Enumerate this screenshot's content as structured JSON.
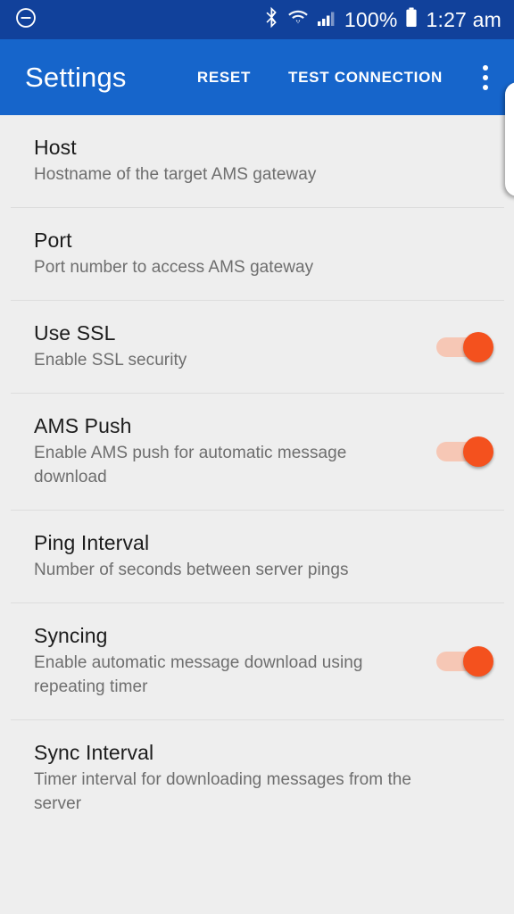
{
  "status_bar": {
    "dnd_icon": "do-not-disturb-icon",
    "bluetooth_icon": "bluetooth-icon",
    "wifi_icon": "wifi-icon",
    "signal_icon": "cellular-signal-icon",
    "battery_percent": "100%",
    "battery_icon": "battery-full-icon",
    "time": "1:27 am",
    "background_color": "#11419b"
  },
  "app_bar": {
    "title": "Settings",
    "reset_label": "RESET",
    "test_connection_label": "TEST CONNECTION",
    "overflow_icon": "overflow-menu-icon",
    "background_color": "#1665cb"
  },
  "side_card": {
    "name": "peeking-panel"
  },
  "theme": {
    "accent_color": "#f4511e",
    "switch_track_color": "#f6c7b5",
    "list_background": "#eeeeee",
    "divider_color": "#dddddd",
    "title_color": "#1c1c1c",
    "summary_color": "#6e6e6e"
  },
  "preferences": [
    {
      "key": "host",
      "title": "Host",
      "summary": "Hostname of the target AMS gateway",
      "has_switch": false
    },
    {
      "key": "port",
      "title": "Port",
      "summary": "Port number to access AMS gateway",
      "has_switch": false
    },
    {
      "key": "use-ssl",
      "title": "Use SSL",
      "summary": "Enable SSL security",
      "has_switch": true,
      "switch_on": true
    },
    {
      "key": "ams-push",
      "title": "AMS Push",
      "summary": "Enable AMS push for automatic message download",
      "has_switch": true,
      "switch_on": true
    },
    {
      "key": "ping-interval",
      "title": "Ping Interval",
      "summary": "Number of seconds between server pings",
      "has_switch": false
    },
    {
      "key": "syncing",
      "title": "Syncing",
      "summary": "Enable automatic message download using repeating timer",
      "has_switch": true,
      "switch_on": true
    },
    {
      "key": "sync-interval",
      "title": "Sync Interval",
      "summary": "Timer interval for downloading messages from the server",
      "has_switch": false
    }
  ]
}
